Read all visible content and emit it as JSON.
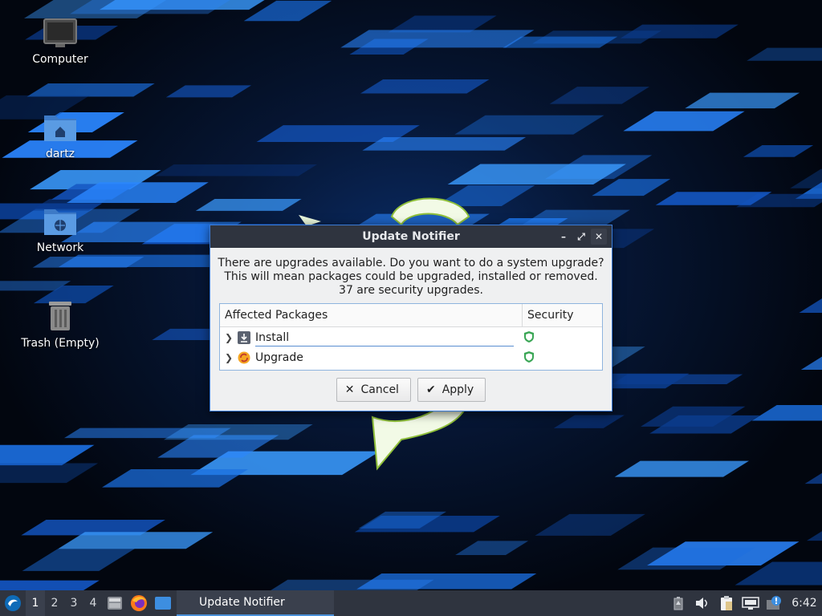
{
  "desktop": {
    "icons": [
      {
        "label": "Computer"
      },
      {
        "label": "dartz"
      },
      {
        "label": "Network"
      },
      {
        "label": "Trash (Empty)"
      }
    ]
  },
  "dialog": {
    "title": "Update Notifier",
    "message_line1": "There are upgrades available. Do you want to do a system upgrade?",
    "message_line2": "This will mean packages could be upgraded, installed or removed.",
    "message_line3": "37 are security upgrades.",
    "columns": {
      "packages": "Affected Packages",
      "security": "Security"
    },
    "rows": [
      {
        "label": "Install",
        "icon": "download-icon",
        "security": "shield-check-icon"
      },
      {
        "label": "Upgrade",
        "icon": "upgrade-icon",
        "security": "shield-check-icon"
      }
    ],
    "cancel_label": "Cancel",
    "apply_label": "Apply",
    "controls": [
      "minimize-icon",
      "maximize-icon",
      "close-icon"
    ]
  },
  "taskbar": {
    "workspaces": [
      "1",
      "2",
      "3",
      "4"
    ],
    "active_workspace": "1",
    "launchers": [
      "file-manager-icon",
      "firefox-icon",
      "show-desktop-icon"
    ],
    "window_title": "Update Notifier",
    "tray": [
      "battery-icon",
      "volume-icon",
      "clipboard-icon",
      "network-icon",
      "update-alert-icon"
    ],
    "clock": "6:42"
  },
  "colors": {
    "accent": "#4a90d9",
    "titlebar": "#2f343f",
    "dialog_bg": "#eff0f1",
    "shield": "#3aa655"
  }
}
